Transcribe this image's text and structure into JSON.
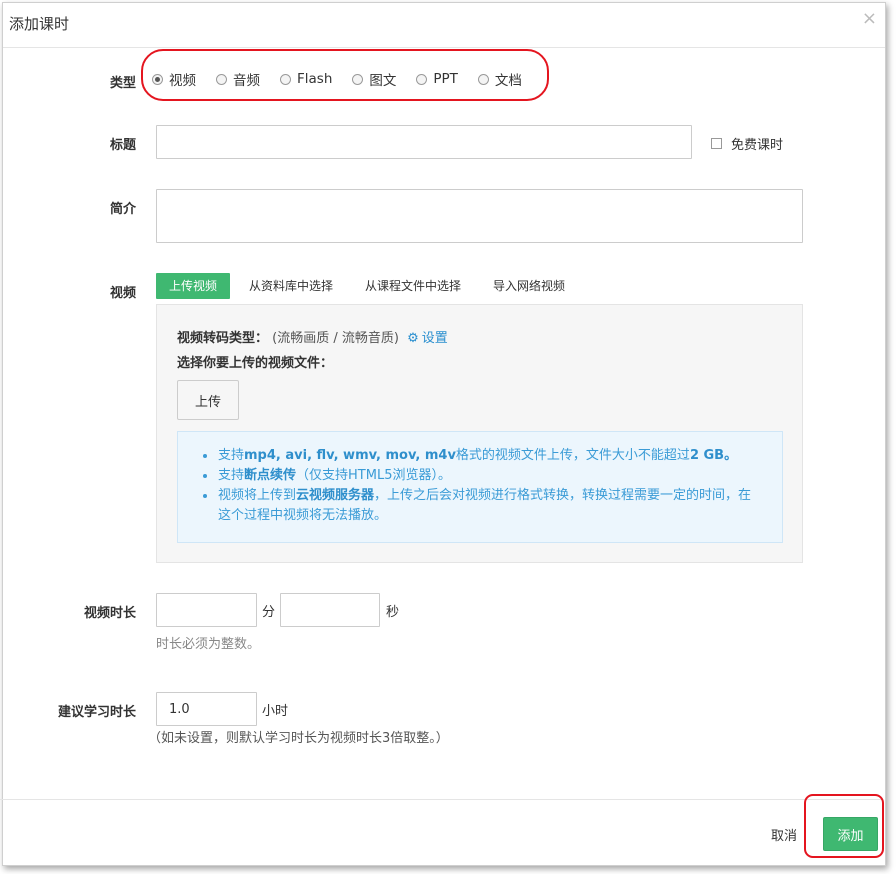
{
  "dialog": {
    "title": "添加课时",
    "close": "×"
  },
  "type_field": {
    "label": "类型",
    "options": [
      {
        "label": "视频",
        "checked": true
      },
      {
        "label": "音频",
        "checked": false
      },
      {
        "label": "Flash",
        "checked": false
      },
      {
        "label": "图文",
        "checked": false
      },
      {
        "label": "PPT",
        "checked": false
      },
      {
        "label": "文档",
        "checked": false
      }
    ]
  },
  "title_field": {
    "label": "标题",
    "value": "",
    "free_lesson_label": "免费课时"
  },
  "summary_field": {
    "label": "简介",
    "value": ""
  },
  "video_field": {
    "label": "视频",
    "tabs": [
      "上传视频",
      "从资料库中选择",
      "从课程文件中选择",
      "导入网络视频"
    ],
    "active_tab": 0,
    "transcode_label": "视频转码类型：",
    "transcode_value": "(流畅画质 / 流畅音质)",
    "settings_link": "设置",
    "choose_file_label": "选择你要上传的视频文件：",
    "upload_button": "上传",
    "info": {
      "item1": {
        "pre": "支持",
        "bold": "mp4, avi, flv, wmv, mov, m4v",
        "mid": "格式的视频文件上传，文件大小不能超过",
        "bold2": "2 GB",
        "post": "。"
      },
      "item2": {
        "pre": "支持",
        "bold": "断点续传",
        "post": "（仅支持HTML5浏览器）。"
      },
      "item3": {
        "pre": "视频将上传到",
        "bold": "云视频服务器",
        "post": "，上传之后会对视频进行格式转换，转换过程需要一定的时间，在这个过程中视频将无法播放。"
      }
    }
  },
  "duration_field": {
    "label": "视频时长",
    "minutes": "",
    "seconds": "",
    "min_unit": "分",
    "sec_unit": "秒",
    "hint": "时长必须为整数。"
  },
  "study_field": {
    "label": "建议学习时长",
    "value": "1.0",
    "unit": "小时",
    "hint": "（如未设置，则默认学习时长为视频时长3倍取整。）"
  },
  "footer": {
    "cancel": "取消",
    "add": "添加"
  }
}
